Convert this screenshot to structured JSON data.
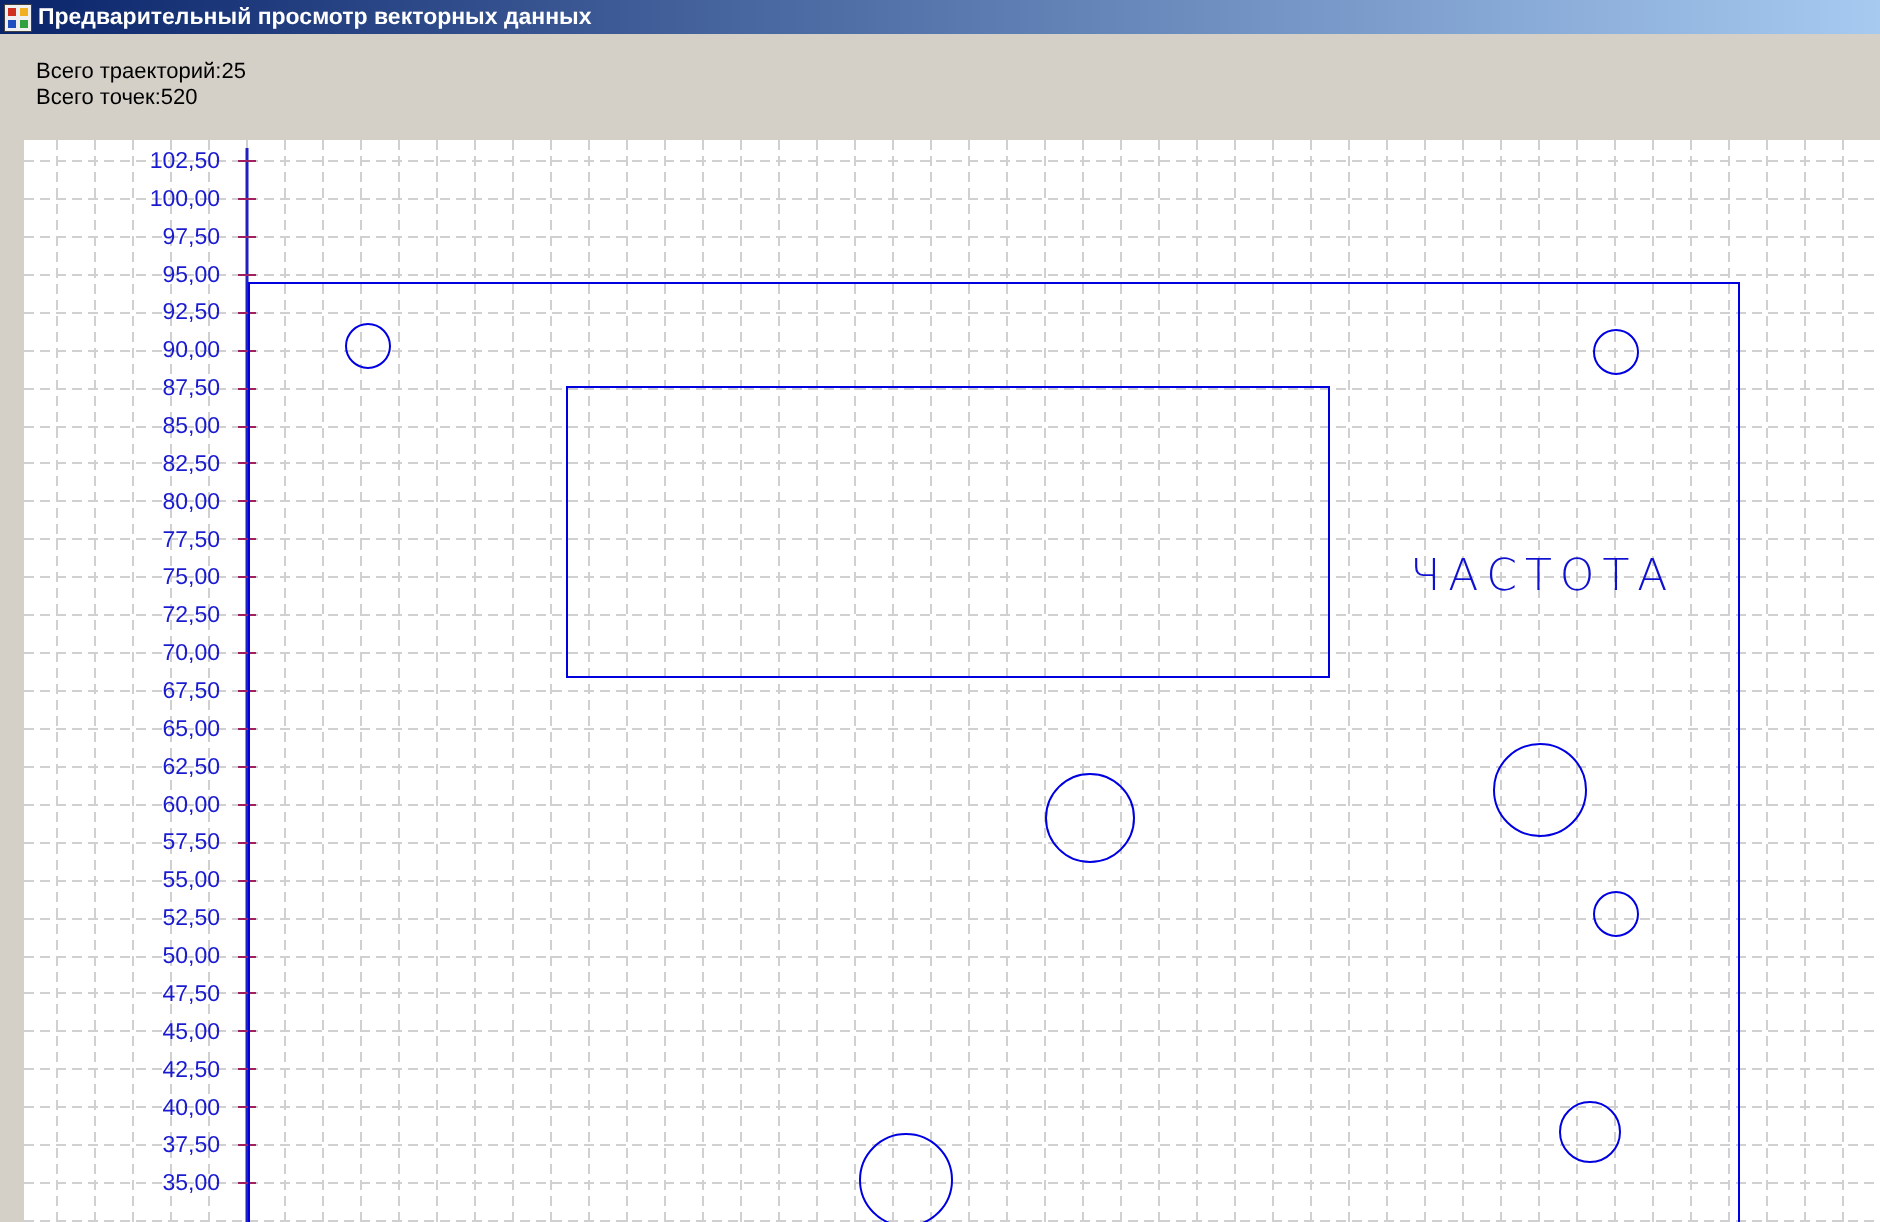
{
  "window": {
    "title": "Предварительный просмотр векторных данных"
  },
  "stats": [
    "Всего траекторий:25",
    "Всего точек:520"
  ],
  "plot": {
    "y_axis_labels": [
      "102,50",
      "100,00",
      "97,50",
      "95,00",
      "92,50",
      "90,00",
      "87,50",
      "85,00",
      "82,50",
      "80,00",
      "77,50",
      "75,00",
      "72,50",
      "70,00",
      "67,50",
      "65,00",
      "62,50",
      "60,00",
      "57,50",
      "55,00",
      "52,50",
      "50,00",
      "47,50",
      "45,00",
      "42,50",
      "40,00",
      "37,50",
      "35,00"
    ],
    "drawing_labels": [
      "ЧАСТОТА"
    ]
  }
}
